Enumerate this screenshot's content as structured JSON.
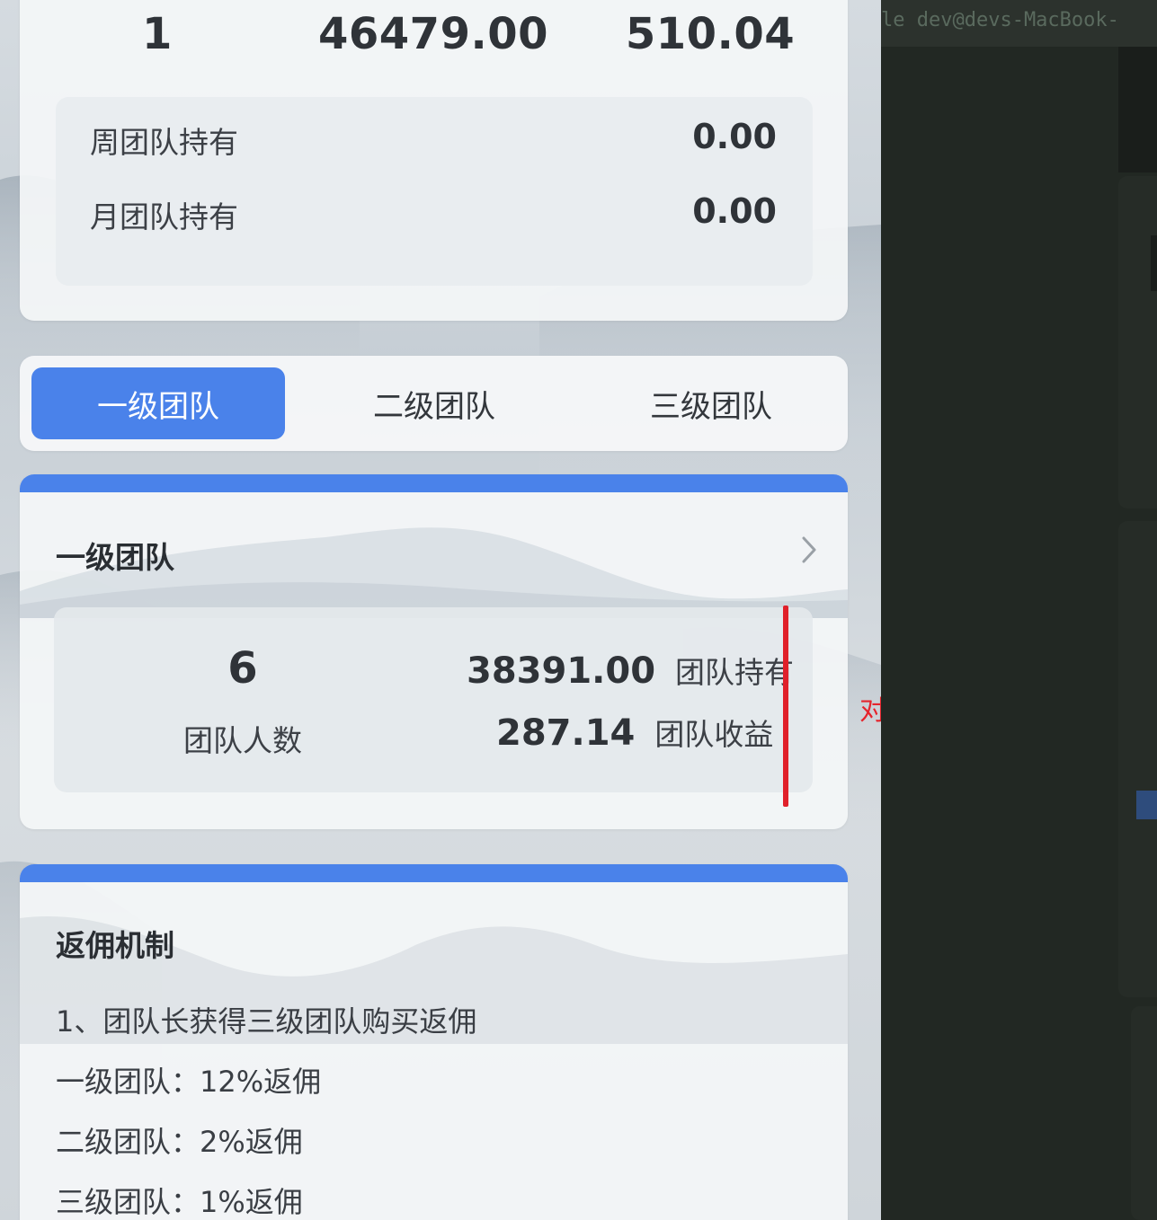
{
  "summary": {
    "values": [
      "1",
      "46479.00",
      "510.04"
    ],
    "rows": [
      {
        "label": "周团队持有",
        "value": "0.00"
      },
      {
        "label": "月团队持有",
        "value": "0.00"
      }
    ]
  },
  "tabs": [
    {
      "label": "一级团队",
      "active": true
    },
    {
      "label": "二级团队",
      "active": false
    },
    {
      "label": "三级团队",
      "active": false
    }
  ],
  "team_card": {
    "title": "一级团队",
    "member_count": "6",
    "member_label": "团队人数",
    "holding_value": "38391.00",
    "holding_label": "团队持有",
    "earning_value": "287.14",
    "earning_label": "团队收益"
  },
  "commission": {
    "title": "返佣机制",
    "lines": [
      "1、团队长获得三级团队购买返佣",
      "一级团队：12%返佣",
      "二级团队：2%返佣",
      "三级团队：1%返佣"
    ]
  },
  "annotation": {
    "label": "对齐",
    "color": "#e0202a"
  },
  "editor": {
    "tab_text": "le  dev@devs-MacBook-"
  },
  "colors": {
    "accent": "#4a82ea",
    "editor_bg": "#222823"
  }
}
